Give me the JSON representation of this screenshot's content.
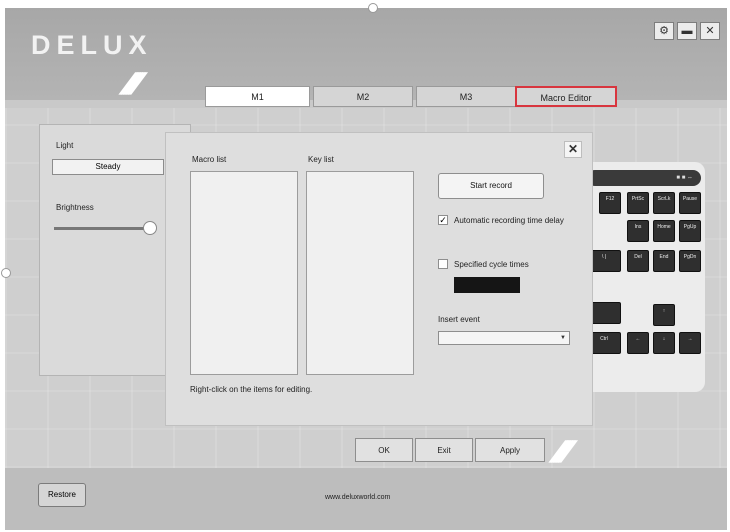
{
  "app": {
    "brand": "DELUX"
  },
  "window_buttons": {
    "settings_icon": "gear-icon",
    "minimize_icon": "minimize-icon",
    "close_icon": "close-icon",
    "settings_glyph": "⚙",
    "minimize_glyph": "▬",
    "close_glyph": "✕"
  },
  "tabs": [
    "M1",
    "M2",
    "M3",
    "Macro Editor"
  ],
  "left_panel": {
    "light_label": "Light",
    "light_mode": "Steady",
    "brightness_label": "Brightness",
    "brightness_level": 0.95
  },
  "macro_dialog": {
    "macro_list_label": "Macro list",
    "key_list_label": "Key list",
    "start_record_label": "Start record",
    "auto_delay_label": "Automatic recording time delay",
    "auto_delay_checked": true,
    "cycle_times_label": "Specified cycle times",
    "cycle_times_checked": false,
    "insert_event_label": "Insert event",
    "insert_event_value": "",
    "hint": "Right-click on the items for editing.",
    "close_glyph": "✕"
  },
  "keyboard": {
    "indicators": "■ ■ ⇔",
    "keys": [
      "F12",
      "PrtSc",
      "ScrLk",
      "Pause",
      "Ins",
      "Home",
      "PgUp",
      "\\ |",
      "Del",
      "End",
      "PgDn",
      "↑",
      "Ctrl",
      "←",
      "↓",
      "→"
    ]
  },
  "bottom_buttons": {
    "ok": "OK",
    "exit": "Exit",
    "apply": "Apply"
  },
  "footer": {
    "restore": "Restore",
    "website": "www.deluxworld.com"
  }
}
